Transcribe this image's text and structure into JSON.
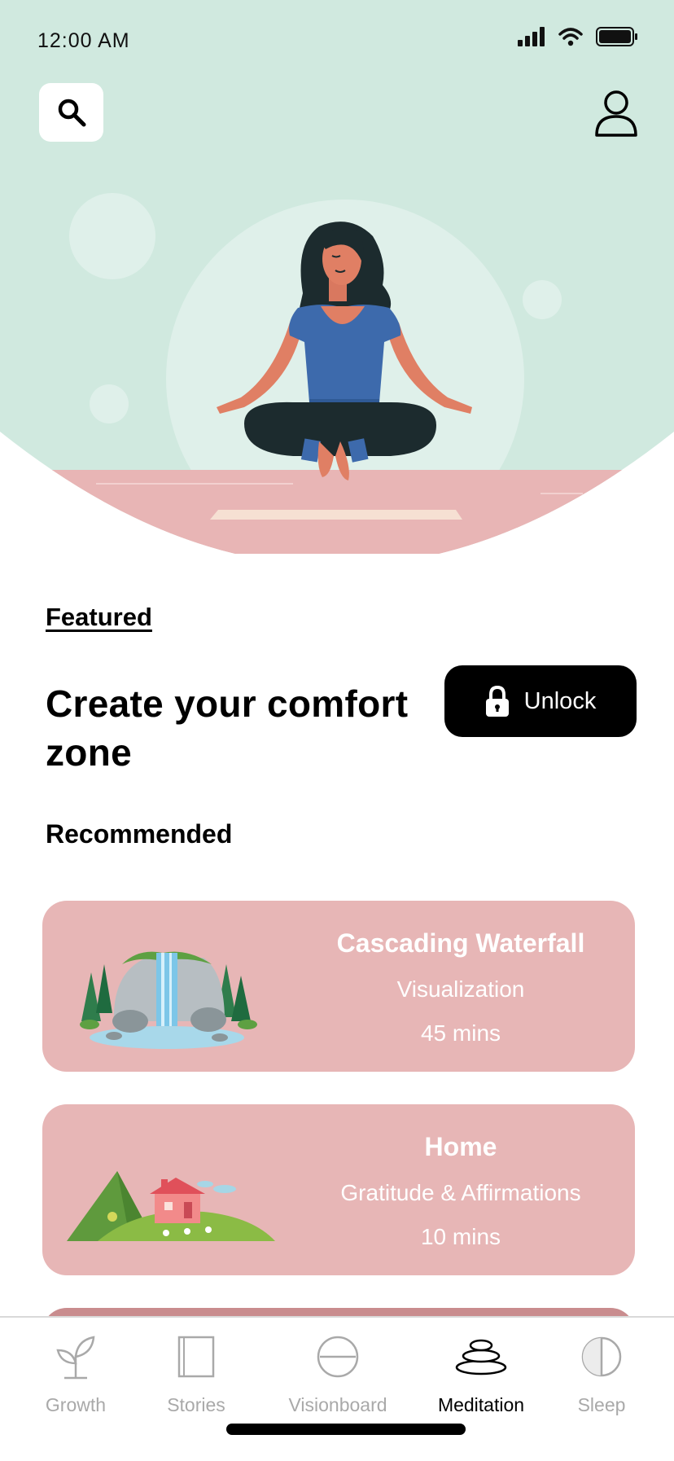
{
  "status_bar": {
    "time": "12:00 AM"
  },
  "header": {
    "search_icon": "search-icon",
    "profile_icon": "user-icon"
  },
  "featured": {
    "label": "Featured",
    "headline": "Create your comfort zone",
    "unlock_label": "Unlock"
  },
  "recommended": {
    "heading": "Recommended",
    "items": [
      {
        "title": "Cascading Waterfall",
        "category": "Visualization",
        "duration": "45 mins"
      },
      {
        "title": "Home",
        "category": "Gratitude & Affirmations",
        "duration": "10 mins"
      }
    ]
  },
  "tabs": [
    {
      "label": "Growth",
      "icon": "sprout-icon",
      "active": false
    },
    {
      "label": "Stories",
      "icon": "book-icon",
      "active": false
    },
    {
      "label": "Visionboard",
      "icon": "minus-circle-icon",
      "active": false
    },
    {
      "label": "Meditation",
      "icon": "stones-icon",
      "active": true
    },
    {
      "label": "Sleep",
      "icon": "half-moon-icon",
      "active": false
    }
  ],
  "colors": {
    "hero_bg": "#d0e9df",
    "floor": "#e8b5b5",
    "card_bg": "#e7b6b6",
    "active_tab": "#000000",
    "inactive_tab": "#a9a9a9"
  }
}
